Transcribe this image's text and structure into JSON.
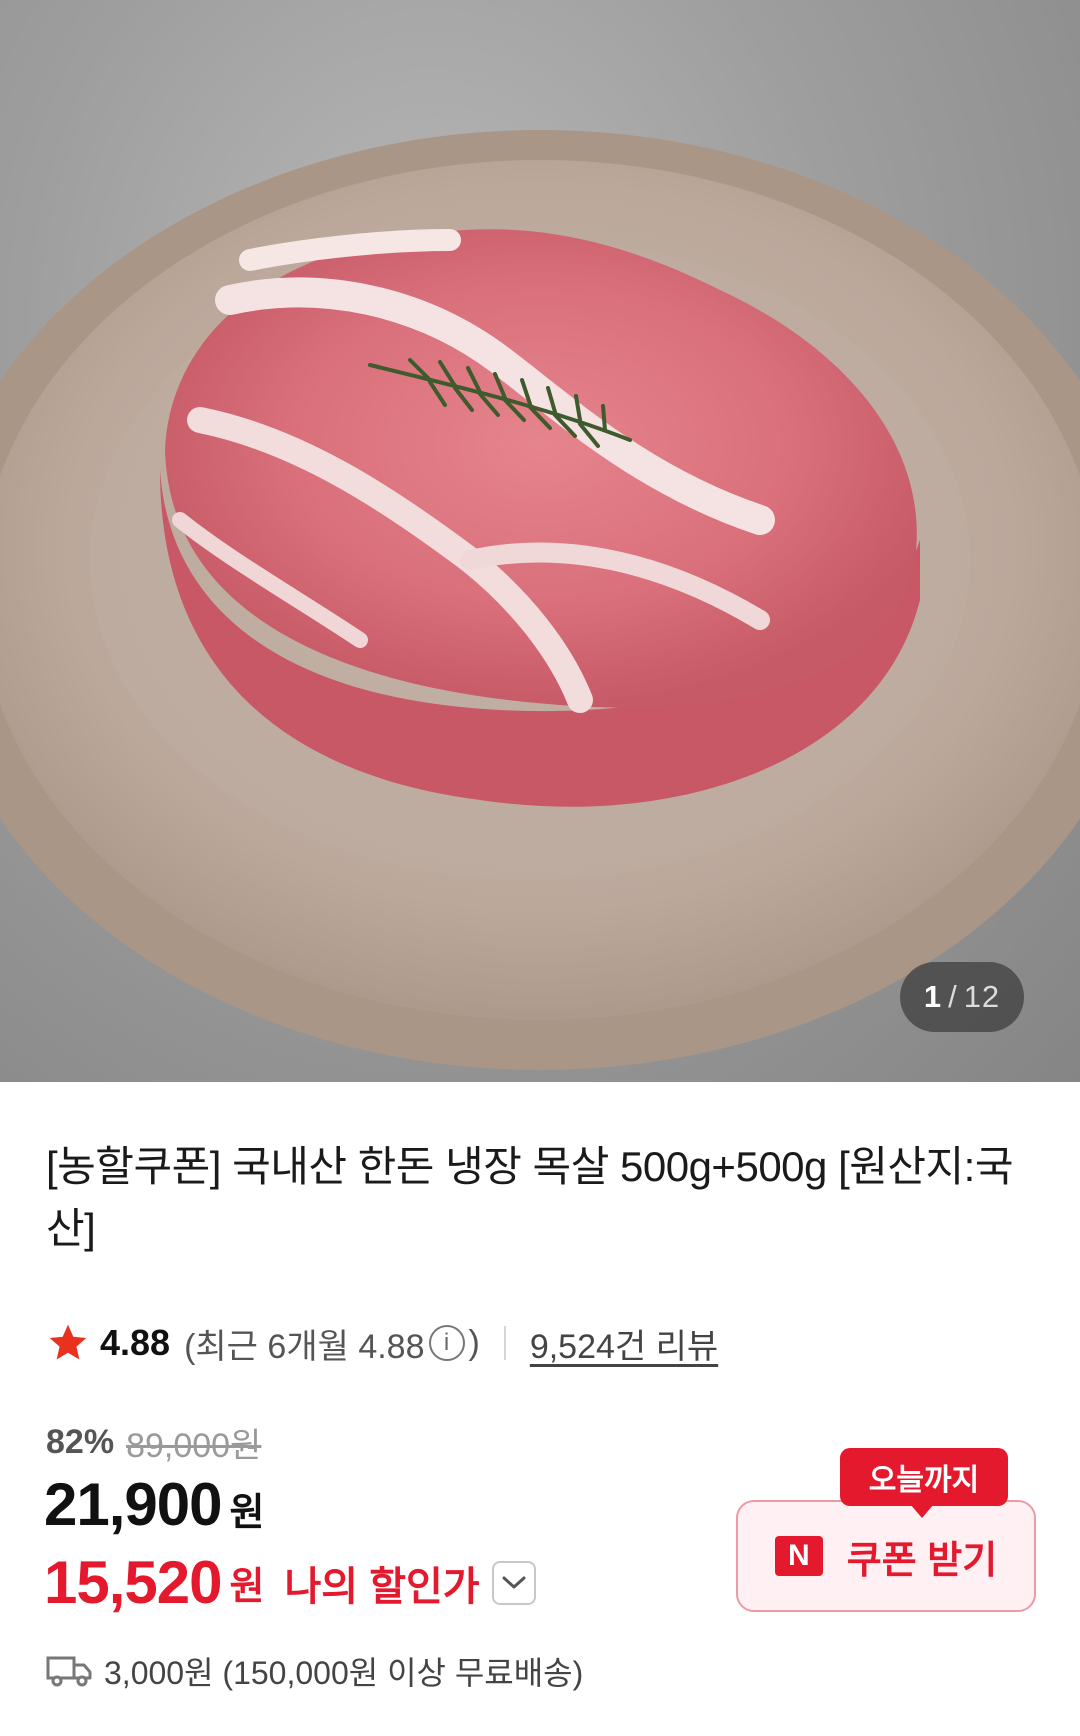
{
  "gallery": {
    "current": "1",
    "separator": "/",
    "total": "12"
  },
  "product": {
    "title": "[농할쿠폰] 국내산 한돈 냉장 목살 500g+500g [원산지:국산]"
  },
  "rating": {
    "score": "4.88",
    "recent_prefix": "(최근 6개월 4.88",
    "recent_suffix": ")",
    "info_glyph": "i",
    "reviews": "9,524건 리뷰"
  },
  "price": {
    "discount_rate": "82%",
    "original": "89,000원",
    "sale": "21,900",
    "currency": "원",
    "my_price": "15,520",
    "my_currency": "원",
    "my_label": "나의 할인가"
  },
  "coupon": {
    "badge": "오늘까지",
    "logo": "N",
    "label": "쿠폰 받기"
  },
  "shipping": {
    "text": "3,000원 (150,000원 이상 무료배송)"
  },
  "icons": {
    "star": "star-icon",
    "info": "info-icon",
    "chevron": "chevron-down-icon",
    "truck": "truck-icon",
    "naver": "naver-logo-icon"
  },
  "colors": {
    "accent_red": "#e5192e",
    "star": "#e8321e",
    "coupon_bg": "#fff1f3"
  }
}
